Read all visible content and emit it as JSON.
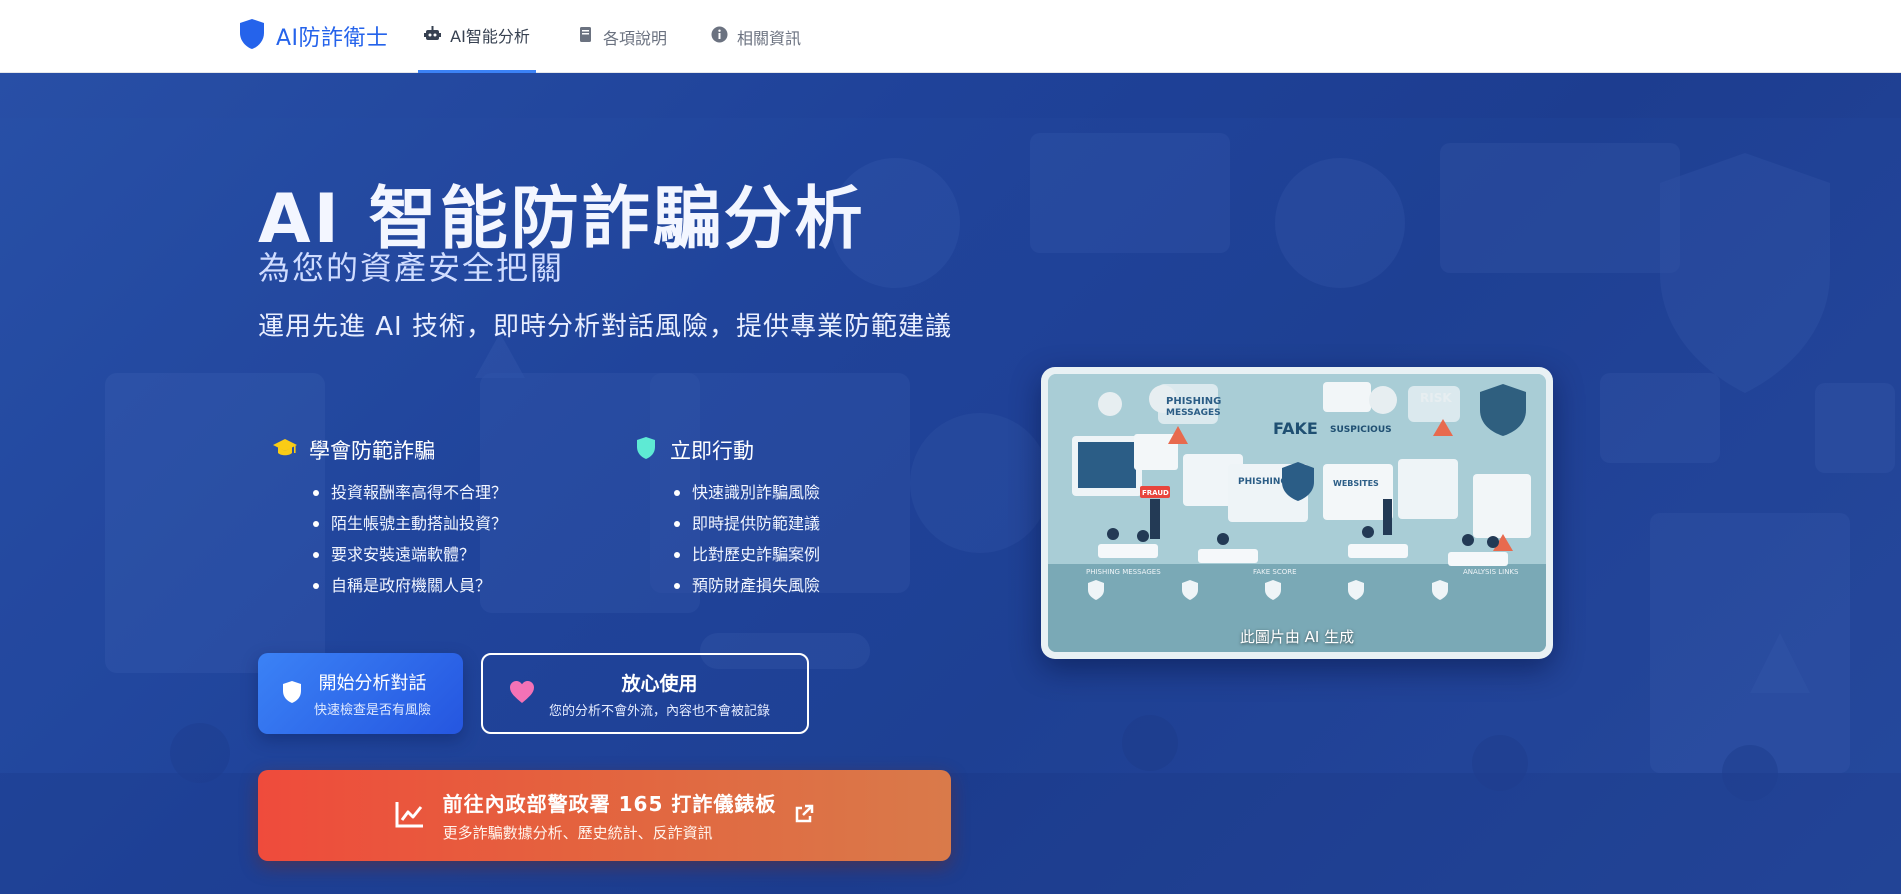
{
  "brand": {
    "name": "AI防詐衛士",
    "icon": "shield-icon",
    "color": "#2563eb"
  },
  "nav": {
    "tabs": [
      {
        "label": "AI智能分析",
        "icon": "robot-icon",
        "active": true
      },
      {
        "label": "各項說明",
        "icon": "book-icon",
        "active": false
      },
      {
        "label": "相關資訊",
        "icon": "info-icon",
        "active": false
      }
    ]
  },
  "hero": {
    "title": "AI 智能防詐騙分析",
    "subtitle": "為您的資產安全把關",
    "description": "運用先進 AI 技術，即時分析對話風險，提供專業防範建議"
  },
  "features": {
    "learn": {
      "heading": "學會防範詐騙",
      "icon": "graduation-cap-icon",
      "items": [
        "投資報酬率高得不合理？",
        "陌生帳號主動搭訕投資？",
        "要求安裝遠端軟體？",
        "自稱是政府機關人員？"
      ]
    },
    "act": {
      "heading": "立即行動",
      "icon": "shield-check-icon",
      "items": [
        "快速識別詐騙風險",
        "即時提供防範建議",
        "比對歷史詐騙案例",
        "預防財產損失風險"
      ]
    }
  },
  "buttons": {
    "start": {
      "label": "開始分析對話",
      "sub": "快速檢查是否有風險",
      "icon": "shield-icon"
    },
    "safe": {
      "label": "放心使用",
      "sub": "您的分析不會外流，內容也不會被記錄",
      "icon": "heart-icon"
    },
    "dashboard": {
      "label": "前往內政部警政署 165 打詐儀錶板",
      "sub": "更多詐騙數據分析、歷史統計、反詐資訊",
      "icon": "chart-line-icon",
      "trailing_icon": "external-link-icon"
    }
  },
  "image_card": {
    "caption": "此圖片由 AI 生成",
    "texts": {
      "t1": "PHISHING",
      "t2": "MESSAGES",
      "t3": "FAKE",
      "t4": "SUSPICIOUS",
      "t5": "WEBSITES",
      "t6": "RISK",
      "t7": "FRAUD",
      "t8": "PHISHING MESSAGES",
      "t9": "FAKE SCORE",
      "t10": "ANALYSIS LINKS"
    }
  },
  "colors": {
    "hero_bg": "#1f4299",
    "accent_blue": "#3b82f6",
    "dashboard_red": "#ef4b3c",
    "mint": "#5eead4",
    "gold": "#facc15",
    "pink": "#f472b6"
  }
}
